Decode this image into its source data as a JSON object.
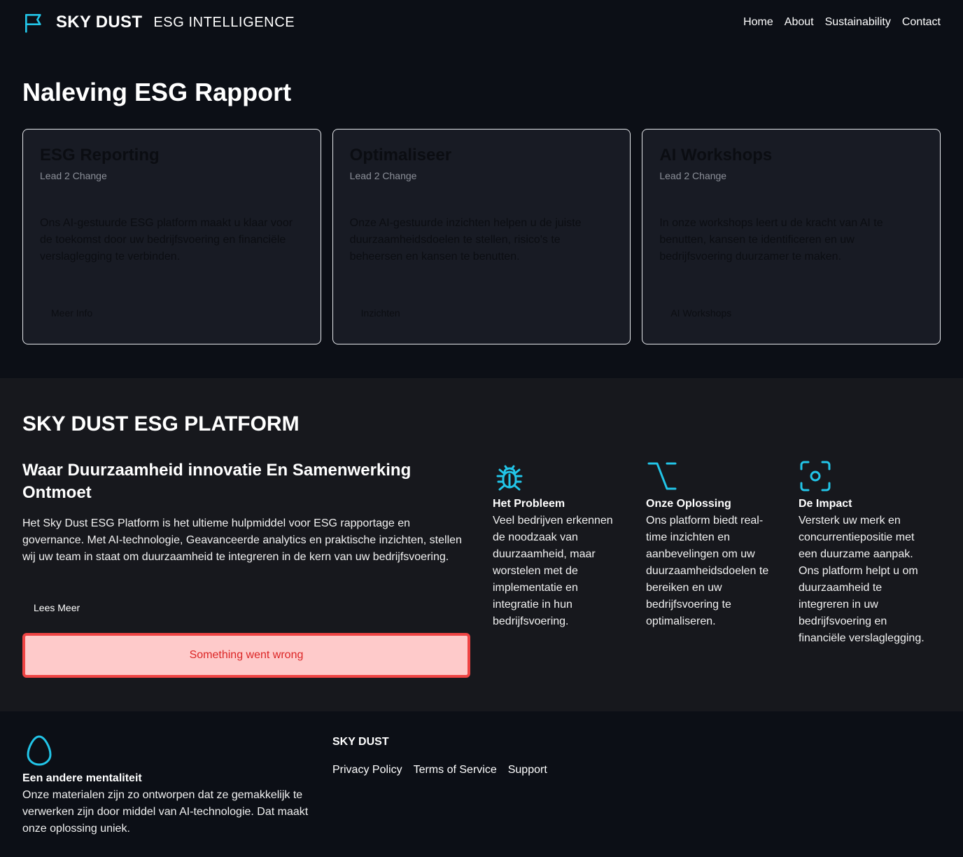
{
  "header": {
    "brand_name": "SKY DUST",
    "tagline": "ESG INTELLIGENCE",
    "logo_icon": "flag-icon",
    "nav": [
      "Home",
      "About",
      "Sustainability",
      "Contact"
    ]
  },
  "hero": {
    "title": "Naleving ESG Rapport",
    "cards": [
      {
        "title": "ESG Reporting",
        "subtitle": "Lead 2 Change",
        "description": "Ons AI-gestuurde ESG platform maakt u klaar voor de toekomst door uw bedrijfsvoering en financiële verslaglegging te verbinden.",
        "button": "Meer Info"
      },
      {
        "title": "Optimaliseer",
        "subtitle": "Lead 2 Change",
        "description": "Onze AI-gestuurde inzichten helpen u de juiste duurzaamheidsdoelen te stellen, risico's te beheersen en kansen te benutten.",
        "button": "Inzichten"
      },
      {
        "title": "AI Workshops",
        "subtitle": "Lead 2 Change",
        "description": "In onze workshops leert u de kracht van AI te benutten, kansen te identificeren en uw bedrijfsvoering duurzamer te maken.",
        "button": "AI Workshops"
      }
    ]
  },
  "platform": {
    "title": "SKY DUST ESG PLATFORM",
    "intro_heading": "Waar Duurzaamheid innovatie En Samenwerking Ontmoet",
    "intro_text": "Het Sky Dust ESG Platform is het ultieme hulpmiddel voor ESG rapportage en governance. Met AI-technologie, Geavanceerde analytics en praktische inzichten, stellen wij uw team in staat om duurzaamheid te integreren in de kern van uw bedrijfsvoering.",
    "read_more": "Lees Meer",
    "error_message": "Something went wrong",
    "features": [
      {
        "icon": "bug-icon",
        "title": "Het Probleem",
        "text": "Veel bedrijven erkennen de noodzaak van duurzaamheid, maar worstelen met de implementatie en integratie in hun bedrijfsvoering."
      },
      {
        "icon": "option-key-icon",
        "title": "Onze Oplossing",
        "text": "Ons platform biedt real-time inzichten en aanbevelingen om uw duurzaamheidsdoelen te bereiken en uw bedrijfsvoering te optimaliseren."
      },
      {
        "icon": "focus-scan-icon",
        "title": "De Impact",
        "text": "Versterk uw merk en concurrentiepositie met een duurzame aanpak. Ons platform helpt u om duurzaamheid te integreren in uw bedrijfsvoering en financiële verslaglegging."
      }
    ]
  },
  "footer": {
    "icon": "egg-icon",
    "title": "Een andere mentaliteit",
    "text": "Onze materialen zijn zo ontworpen dat ze gemakkelijk te verwerken zijn door middel van AI-technologie. Dat maakt onze oplossing uniek.",
    "brand": "SKY DUST",
    "links": [
      "Privacy Policy",
      "Terms of Service",
      "Support"
    ]
  },
  "colors": {
    "background": "#0c0f16",
    "section_background": "#17181d",
    "card_background": "#181b24",
    "accent_cyan": "#22c5e8",
    "error_background": "#fecaca",
    "error_border": "#ef4444",
    "error_text": "#dc2626"
  }
}
